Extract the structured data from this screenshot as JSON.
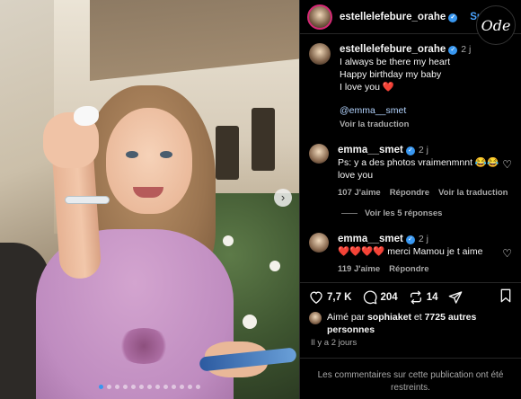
{
  "post": {
    "author": "estellelefebure_orahe",
    "follow_label": "Suivre",
    "brand_logo_text": "Ode",
    "carousel": {
      "slides": 13,
      "active_index": 0
    }
  },
  "caption": {
    "author": "estellelefebure_orahe",
    "time": "2 j",
    "lines": [
      "I always be there my heart",
      "Happy birthday my baby",
      "I love you ❤️"
    ],
    "mention": "@emma__smet",
    "translate": "Voir la traduction"
  },
  "comments": [
    {
      "author": "emma__smet",
      "time": "2 j",
      "text": "Ps: y a des photos vraimenmnnt 😂😂 love you",
      "likes": "107 J'aime",
      "reply": "Répondre",
      "translate": "Voir la traduction",
      "replies": "Voir les 5 réponses"
    },
    {
      "author": "emma__smet",
      "time": "2 j",
      "text": "❤️❤️❤️❤️ merci Mamou je t aime",
      "likes": "119 J'aime",
      "reply": "Répondre"
    }
  ],
  "actions": {
    "likes_count": "7,7 K",
    "comments_count": "204",
    "reposts_count": "14"
  },
  "liked_by": {
    "prefix": "Aimé par",
    "user": "sophiaket",
    "suffix": "et",
    "others": "7725 autres personnes"
  },
  "date": "Il y a 2 jours",
  "restricted_notice": "Les commentaires sur cette publication ont été restreints.",
  "colors": {
    "accent": "#3897f0",
    "follow": "#4aa3ff",
    "heart": "#ed4956",
    "background": "#000000"
  }
}
